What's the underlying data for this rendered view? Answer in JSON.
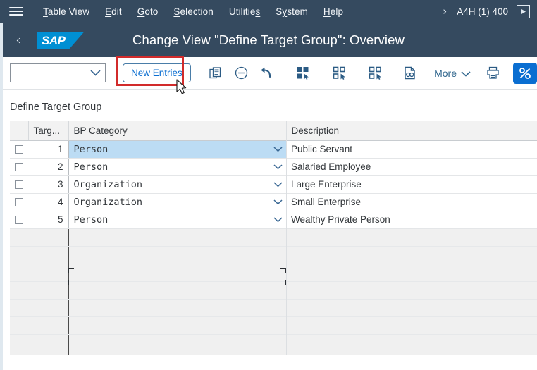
{
  "menubar": {
    "hamburger_icon": "hamburger-menu-icon",
    "items": [
      {
        "label": "Table View",
        "accesskey": "T"
      },
      {
        "label": "Edit",
        "accesskey": "E"
      },
      {
        "label": "Goto",
        "accesskey": "G"
      },
      {
        "label": "Selection",
        "accesskey": "S"
      },
      {
        "label": "Utilities",
        "accesskey": "s"
      },
      {
        "label": "System",
        "accesskey": "y"
      },
      {
        "label": "Help",
        "accesskey": "H"
      }
    ],
    "overflow_icon": "chevron-right-icon",
    "system_id": "A4H (1) 400",
    "play_icon": "play-button-icon"
  },
  "titlebar": {
    "back_icon": "back-chevron-icon",
    "logo_text": "SAP",
    "title": "Change View \"Define Target Group\": Overview"
  },
  "toolbar": {
    "variant_select_value": "",
    "variant_select_placeholder": "",
    "new_entries_label": "New Entries",
    "buttons": [
      {
        "name": "copy-as-icon",
        "tooltip": "Copy As"
      },
      {
        "name": "delete-icon",
        "tooltip": "Delete"
      },
      {
        "name": "undo-icon",
        "tooltip": "Undo"
      },
      {
        "name": "select-all-icon",
        "tooltip": "Select All"
      },
      {
        "name": "deselect-all-icon",
        "tooltip": "Deselect All"
      },
      {
        "name": "select-block-icon",
        "tooltip": "Select Block"
      },
      {
        "name": "display-details-icon",
        "tooltip": "Details"
      }
    ],
    "more_label": "More",
    "more_chevron_icon": "chevron-down-icon",
    "print_icon": "print-icon",
    "accent_button_icon": "percent-icon"
  },
  "main": {
    "section_title": "Define Target Group",
    "table": {
      "columns": [
        "",
        "Targ...",
        "BP Category",
        "Description"
      ],
      "rows": [
        {
          "checked": false,
          "target": "1",
          "category": "Person",
          "description": "Public Servant"
        },
        {
          "checked": false,
          "target": "2",
          "category": "Person",
          "description": "Salaried Employee"
        },
        {
          "checked": false,
          "target": "3",
          "category": "Organization",
          "description": "Large Enterprise"
        },
        {
          "checked": false,
          "target": "4",
          "category": "Organization",
          "description": "Small Enterprise"
        },
        {
          "checked": false,
          "target": "5",
          "category": "Person",
          "description": "Wealthy Private Person"
        }
      ],
      "empty_row_count": 8,
      "selected_row_index": 0,
      "cell_chevron_icon": "chevron-down-icon"
    }
  },
  "colors": {
    "shell_background": "#354a5f",
    "brand_blue": "#008fd3",
    "accent_blue": "#0a6ed1",
    "highlight_red": "#d22b2b",
    "row_selected": "#bcdcf4",
    "header_grey": "#f2f2f2"
  }
}
